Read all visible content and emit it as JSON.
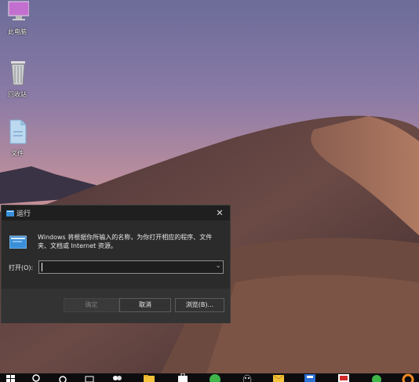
{
  "desktop": {
    "icons": [
      {
        "label": "此电脑",
        "icon": "this-pc-icon"
      },
      {
        "label": "回收站",
        "icon": "recycle-bin-icon"
      },
      {
        "label": "文件",
        "icon": "folder-icon"
      }
    ]
  },
  "run_dialog": {
    "title": "运行",
    "close_glyph": "✕",
    "message": "Windows 将根据你所输入的名称，为你打开相应的程序、文件夹、文档或 Internet 资源。",
    "open_label": "打开(O):",
    "open_value": "",
    "buttons": {
      "ok": "确定",
      "cancel": "取消",
      "browse": "浏览(B)..."
    }
  },
  "taskbar": {
    "items": [
      "start-icon",
      "search-icon",
      "cortana-icon",
      "task-view-icon",
      "people-icon",
      "file-explorer-icon",
      "store-icon",
      "app-green-icon",
      "qq-icon",
      "mail-icon",
      "app-blue-icon",
      "app-red-icon",
      "wechat-icon",
      "app-orange-icon"
    ]
  },
  "colors": {
    "dialog_bg": "#2b2b2b",
    "titlebar_bg": "#1f1f1f",
    "taskbar_bg": "#0d0d0f",
    "accent_blue": "#3a8fd9"
  }
}
